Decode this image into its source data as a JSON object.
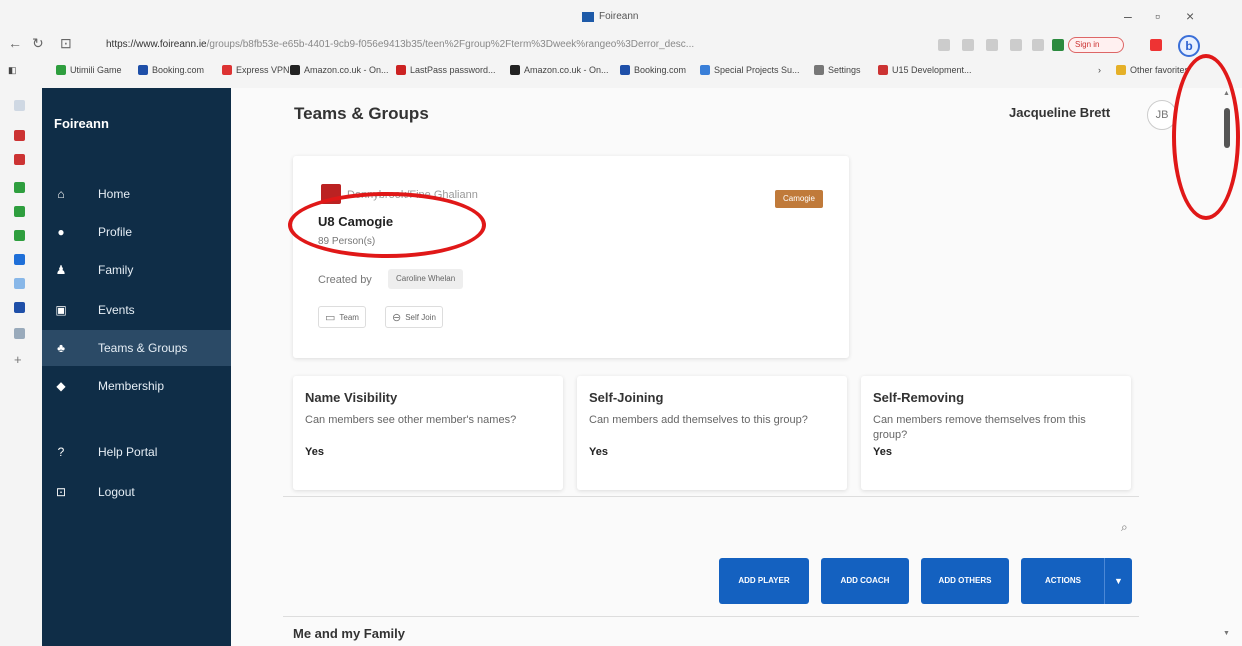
{
  "browser": {
    "window_title": "Foireann",
    "url_domain": "https://www.foireann.ie",
    "url_rest": "/groups/b8fb53e-e65b-4401-9cb9-f056e9413b35/teen%2Fgroup%2Fterm%3Dweek%rangeo%3Derror_desc...",
    "sign_in_label": "Sign in",
    "bookmarks": [
      {
        "label": "Utimili Game",
        "color": "#2e9e3e"
      },
      {
        "label": "Booking.com",
        "color": "#1e4fa8"
      },
      {
        "label": "Express VPN",
        "color": "#d33"
      },
      {
        "label": "Amazon.co.uk - On...",
        "color": "#222"
      },
      {
        "label": "LastPass password...",
        "color": "#c22"
      },
      {
        "label": "Amazon.co.uk - On...",
        "color": "#222"
      },
      {
        "label": "Booking.com",
        "color": "#1e4fa8"
      },
      {
        "label": "Special Projects Su...",
        "color": "#3a7fd8"
      },
      {
        "label": "Settings",
        "color": "#777"
      },
      {
        "label": "U15 Development...",
        "color": "#c33"
      },
      {
        "label": "Other favorites",
        "color": "#e5b028"
      }
    ]
  },
  "sidebar": {
    "brand": "Foireann",
    "items": [
      {
        "label": "Home",
        "icon": "home-icon",
        "glyph": "⌂"
      },
      {
        "label": "Profile",
        "icon": "person-icon",
        "glyph": "●"
      },
      {
        "label": "Family",
        "icon": "family-icon",
        "glyph": "♟"
      },
      {
        "label": "Events",
        "icon": "calendar-icon",
        "glyph": "▣"
      },
      {
        "label": "Teams & Groups",
        "icon": "groups-icon",
        "glyph": "♣"
      },
      {
        "label": "Membership",
        "icon": "shield-icon",
        "glyph": "◆"
      },
      {
        "label": "Help Portal",
        "icon": "help-icon",
        "glyph": "?"
      },
      {
        "label": "Logout",
        "icon": "logout-icon",
        "glyph": "⊡"
      }
    ]
  },
  "header": {
    "title": "Teams & Groups",
    "user_name": "Jacqueline Brett",
    "avatar_initials": "JB"
  },
  "group": {
    "club": "Donnybrook/Fine Ghaliann",
    "category_badge": "Camogie",
    "name": "U8 Camogie",
    "persons": "89 Person(s)",
    "created_label": "Created by",
    "created_by": "Caroline Whelan",
    "tags": [
      "Team",
      "Self Join"
    ]
  },
  "settings": [
    {
      "title": "Name Visibility",
      "question": "Can members see other member's names?",
      "answer": "Yes"
    },
    {
      "title": "Self-Joining",
      "question": "Can members add themselves to this group?",
      "answer": "Yes"
    },
    {
      "title": "Self-Removing",
      "question": "Can members remove themselves from this group?",
      "answer": "Yes"
    }
  ],
  "actions": {
    "add_player": "ADD PLAYER",
    "add_coach": "ADD COACH",
    "add_others": "ADD OTHERS",
    "actions": "ACTIONS"
  },
  "section": {
    "title": "Me and my Family"
  },
  "colors": {
    "sidebar_bg": "#0f2d47",
    "primary_button": "#1461c0",
    "badge": "#c07a3a",
    "annotation": "#e01818"
  }
}
